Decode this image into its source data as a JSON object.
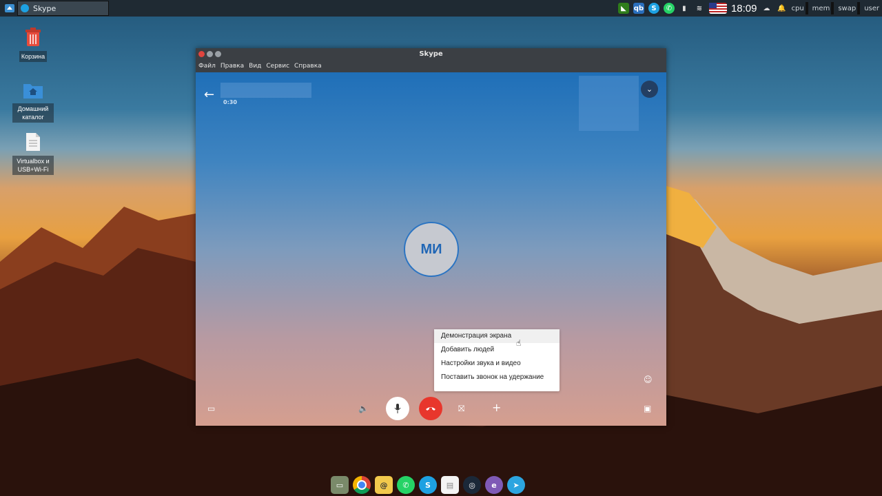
{
  "taskbar": {
    "active_task": "Skype",
    "clock": "18:09",
    "tray_labels": [
      "cpu",
      "mem",
      "swap",
      "user"
    ],
    "tray_icons": [
      "nvidia-icon",
      "qbittorrent-icon",
      "skype-tray-icon",
      "whatsapp-icon",
      "battery-icon",
      "network-icon",
      "us-flag-icon",
      "weather-icon",
      "bell-icon"
    ]
  },
  "desktop_icons": [
    {
      "label": "Корзина",
      "icon": "trash-icon"
    },
    {
      "label": "Домашний каталог",
      "icon": "home-folder-icon"
    },
    {
      "label": "Virtualbox и USB+Wi-Fi",
      "icon": "document-icon"
    }
  ],
  "window": {
    "title": "Skype",
    "menu": [
      "Файл",
      "Правка",
      "Вид",
      "Сервис",
      "Справка"
    ]
  },
  "call": {
    "timer": "0:30",
    "avatar_initials": "МИ",
    "context_menu": [
      "Демонстрация экрана",
      "Добавить людей",
      "Настройки звука и видео",
      "Поставить звонок на удержание"
    ]
  },
  "dock_icons": [
    "file-manager-icon",
    "chrome-icon",
    "mail-icon",
    "whatsapp-icon",
    "skype-icon",
    "text-file-icon",
    "steam-icon",
    "emacs-icon",
    "telegram-icon"
  ],
  "colors": {
    "hangup": "#e8362c",
    "avatar_text": "#2066b5",
    "call_top": "#1f6fb8"
  }
}
